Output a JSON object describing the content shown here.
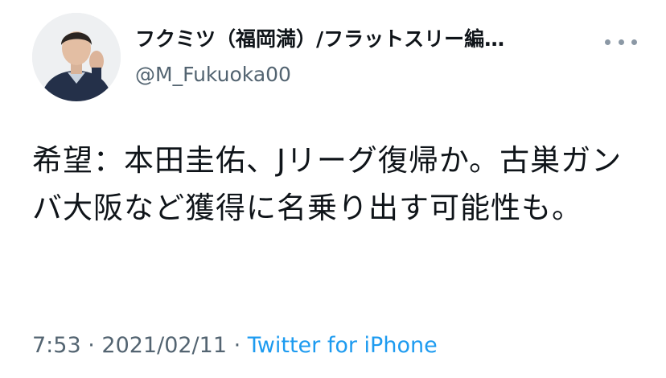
{
  "tweet": {
    "display_name": "フクミツ（福岡満）/フラットスリー編…",
    "handle": "@M_Fukuoka00",
    "text": "希望：本田圭佑、Jリーグ復帰か。古巣ガンバ大阪など獲得に名乗り出す可能性も。",
    "time": "7:53",
    "separator1": " · ",
    "date": "2021/02/11",
    "separator2": " · ",
    "source": "Twitter for iPhone"
  },
  "icons": {
    "more": "more-options-icon",
    "avatar": "profile-photo"
  },
  "colors": {
    "text": "#0f1419",
    "secondary": "#536471",
    "link": "#1d9bf0"
  }
}
